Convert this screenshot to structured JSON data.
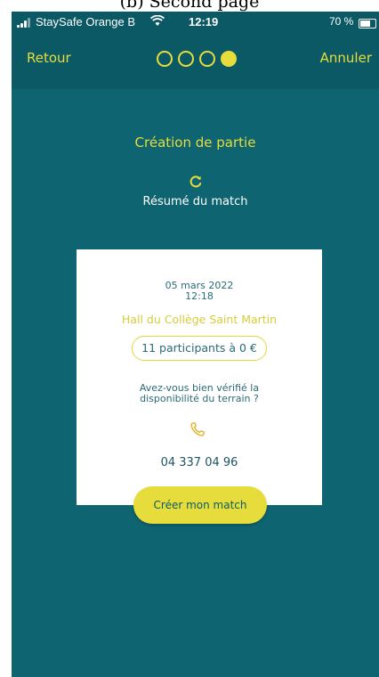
{
  "caption": "(b) Second page",
  "status_bar": {
    "carrier": "StaySafe Orange B",
    "time": "12:19",
    "battery": "70 %"
  },
  "header": {
    "back_label": "Retour",
    "cancel_label": "Annuler",
    "steps_total": 4,
    "current_step": 4
  },
  "title": "Création de partie",
  "subtitle": "Résumé du match",
  "card": {
    "date": "05 mars 2022",
    "time": "12:18",
    "place": "Hall du Collège Saint Martin",
    "participants": "11 participants à 0 €",
    "question_line1": "Avez-vous bien vérifié la",
    "question_line2": "disponibilité du terrain ?",
    "phone": "04 337 04 96"
  },
  "cta_label": "Créer mon match",
  "colors": {
    "background": "#0e6470",
    "accent": "#e6dd3c",
    "card": "#ffffff",
    "text_dark": "#2b6a75"
  }
}
